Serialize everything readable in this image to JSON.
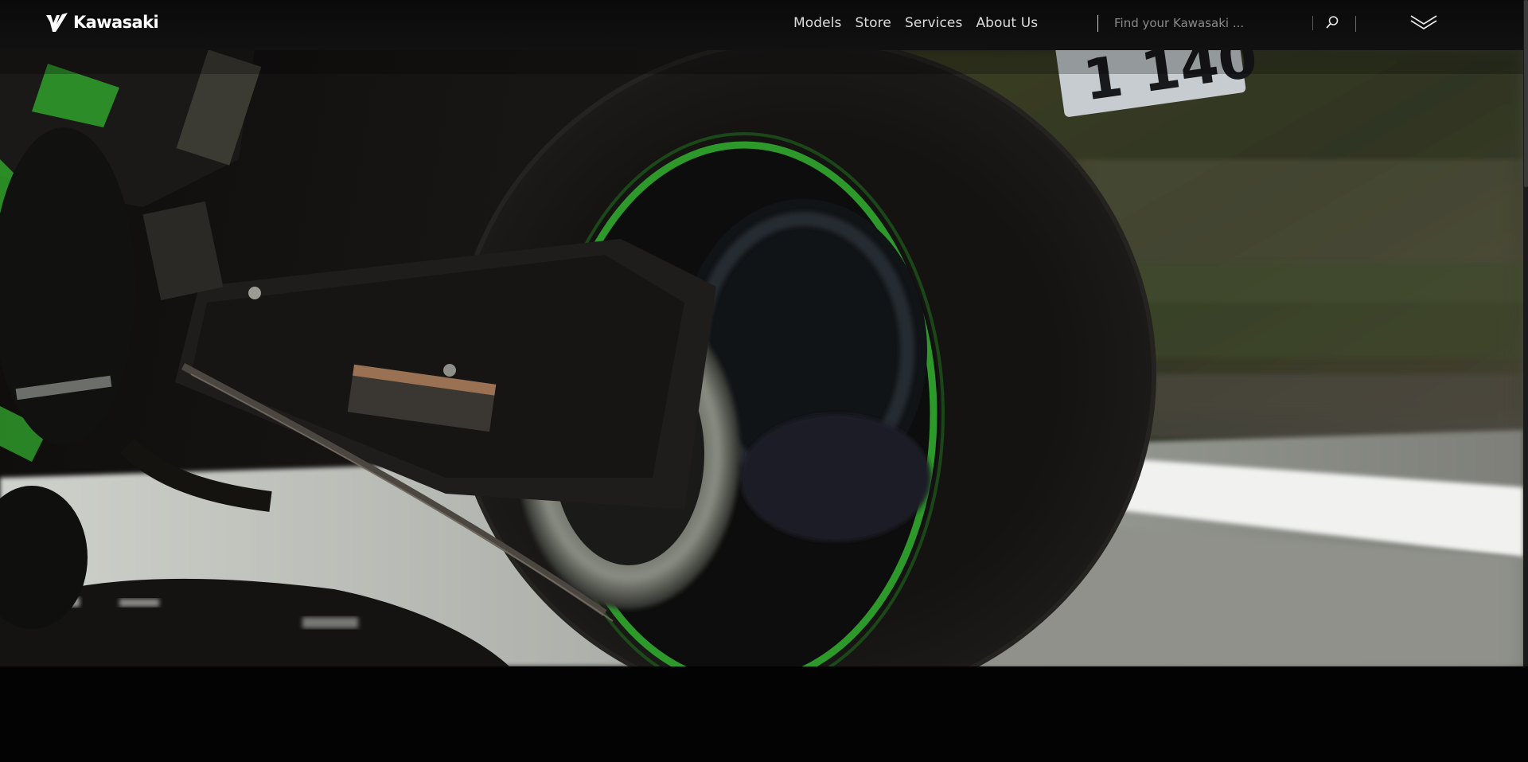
{
  "header": {
    "brand": "Kawasaki",
    "nav": [
      {
        "label": "Models"
      },
      {
        "label": "Store"
      },
      {
        "label": "Services"
      },
      {
        "label": "About Us"
      }
    ],
    "search": {
      "placeholder": "Find your Kawasaki ...",
      "value": ""
    }
  },
  "icons": {
    "logo": "kawasaki-river-mark-icon",
    "search": "search-icon",
    "menu": "double-chevron-down-icon"
  },
  "hero": {
    "plate_text": "1 140",
    "accent_color": "#2fa12c"
  },
  "colors": {
    "header_bg": "#0f0f0f",
    "page_bg": "#030303",
    "brand_green": "#2fa12c"
  }
}
